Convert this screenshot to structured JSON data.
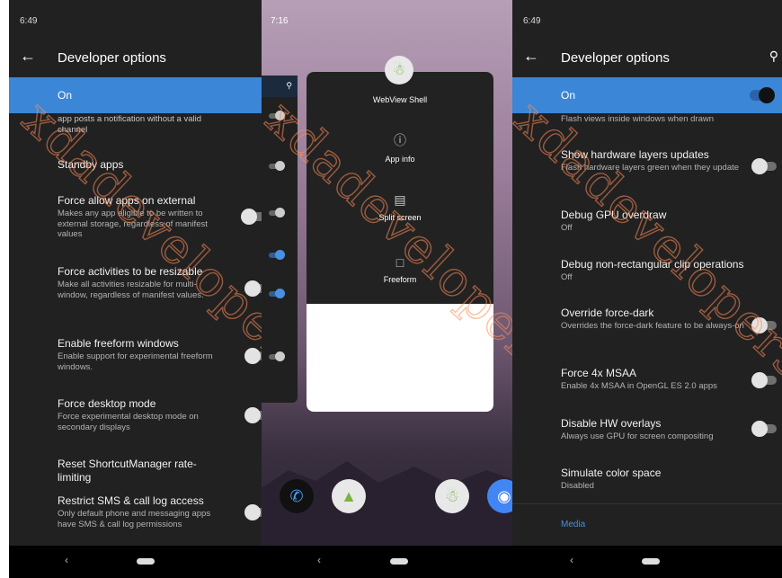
{
  "left": {
    "time": "6:49",
    "title": "Developer options",
    "on_label": "On",
    "partial": "app posts a notification without a valid channel",
    "rows": [
      {
        "title": "Standby apps",
        "sub": ""
      },
      {
        "title": "Force allow apps on external",
        "sub": "Makes any app eligible to be written to external storage, regardless of manifest values"
      },
      {
        "title": "Force activities to be resizable",
        "sub": "Make all activities resizable for multi-window, regardless of manifest values."
      },
      {
        "title": "Enable freeform windows",
        "sub": "Enable support for experimental freeform windows."
      },
      {
        "title": "Force desktop mode",
        "sub": "Force experimental desktop mode on secondary displays"
      },
      {
        "title": "Reset ShortcutManager rate-limiting",
        "sub": ""
      },
      {
        "title": "Restrict SMS & call log access",
        "sub": "Only default phone and messaging apps have SMS & call log permissions"
      }
    ]
  },
  "middle": {
    "time": "7:16",
    "app_name": "WebView Shell",
    "menu": [
      {
        "label": "App info",
        "icon": "info-icon"
      },
      {
        "label": "Split screen",
        "icon": "split-screen-icon"
      },
      {
        "label": "Freeform",
        "icon": "freeform-icon"
      }
    ]
  },
  "right": {
    "time": "6:49",
    "title": "Developer options",
    "on_label": "On",
    "partial": "Flash views inside windows when drawn",
    "rows": [
      {
        "title": "Show hardware layers updates",
        "sub": "Flash hardware layers green when they update"
      },
      {
        "title": "Debug GPU overdraw",
        "sub": "Off"
      },
      {
        "title": "Debug non-rectangular clip operations",
        "sub": "Off"
      },
      {
        "title": "Override force-dark",
        "sub": "Overrides the force-dark feature to be always-on"
      },
      {
        "title": "Force 4x MSAA",
        "sub": "Enable 4x MSAA in OpenGL ES 2.0 apps"
      },
      {
        "title": "Disable HW overlays",
        "sub": "Always use GPU for screen compositing"
      },
      {
        "title": "Simulate color space",
        "sub": "Disabled"
      }
    ],
    "section": "Media"
  },
  "watermark": "xdadevelopers",
  "colors": {
    "accent": "#3b86d6",
    "background": "#212121",
    "watermark": "#ff8c5a"
  }
}
